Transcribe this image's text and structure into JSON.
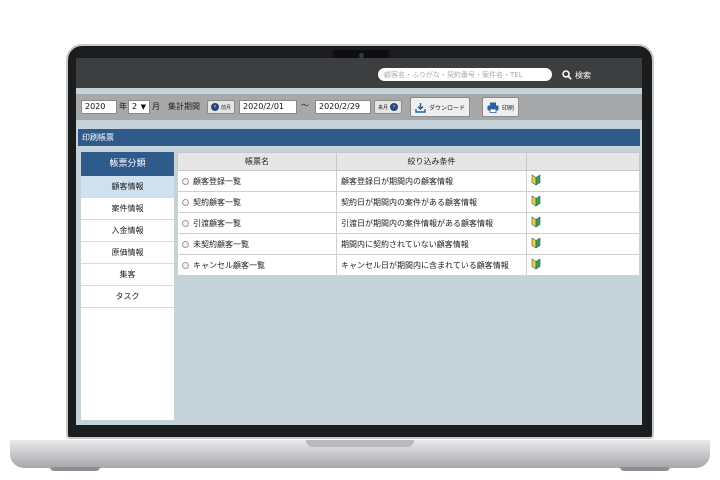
{
  "search": {
    "placeholder": "顧客名・ふりがな・契約番号・案件名・TEL",
    "button_label": "検索"
  },
  "period": {
    "year": "2020",
    "year_unit": "年",
    "month": "2",
    "month_unit": "月",
    "label": "集計期間",
    "prev_label": "前月",
    "start_date": "2020/2/01",
    "separator": "〜",
    "end_date": "2020/2/29",
    "next_label": "来月"
  },
  "toolbar": {
    "download_label": "ダウンロード",
    "print_label": "印刷"
  },
  "section_title": "印刷帳票",
  "sidebar": {
    "header": "帳票分類",
    "items": [
      {
        "label": "顧客情報"
      },
      {
        "label": "案件情報"
      },
      {
        "label": "入金情報"
      },
      {
        "label": "原価情報"
      },
      {
        "label": "集客"
      },
      {
        "label": "タスク"
      }
    ]
  },
  "table": {
    "columns": [
      "帳票名",
      "絞り込み条件",
      ""
    ],
    "rows": [
      {
        "name": "顧客登録一覧",
        "condition": "顧客登録日が期間内の顧客情報"
      },
      {
        "name": "契約顧客一覧",
        "condition": "契約日が期間内の案件がある顧客情報"
      },
      {
        "name": "引渡顧客一覧",
        "condition": "引渡日が期間内の案件情報がある顧客情報"
      },
      {
        "name": "未契約顧客一覧",
        "condition": "期間内に契約されていない顧客情報"
      },
      {
        "name": "キャンセル顧客一覧",
        "condition": "キャンセル日が期間内に含まれている顧客情報"
      }
    ]
  },
  "colors": {
    "header_blue": "#2e5a8c",
    "topbar": "#3c3e40",
    "background": "#c5d2da"
  },
  "icons": {
    "search": "search-icon",
    "download": "download-icon",
    "print": "printer-icon",
    "row": "beginner-mark-icon"
  }
}
